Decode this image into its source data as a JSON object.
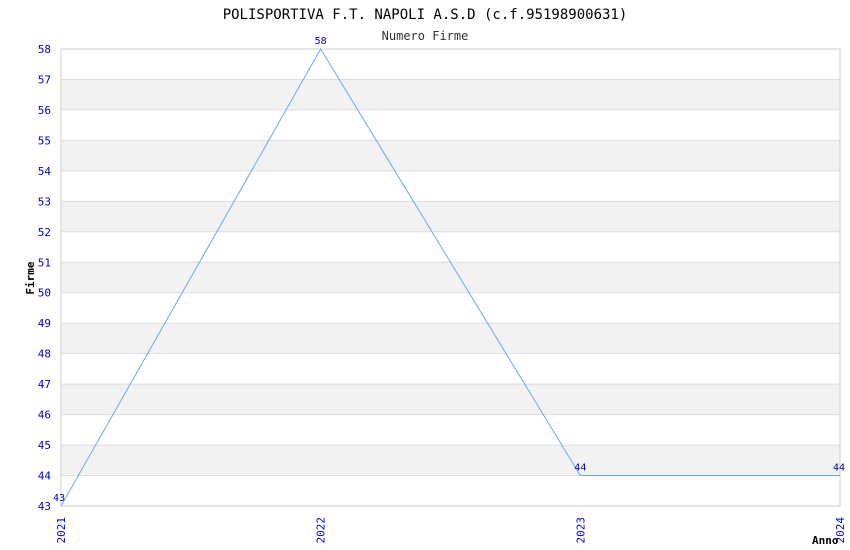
{
  "chart_data": {
    "type": "line",
    "title": "POLISPORTIVA F.T. NAPOLI A.S.D (c.f.95198900631)",
    "subtitle": "Numero Firme",
    "xlabel": "Anno",
    "ylabel": "Firme",
    "x": [
      "2021",
      "2022",
      "2023",
      "2024"
    ],
    "values": [
      43,
      58,
      44,
      44
    ],
    "ylim": [
      43,
      58
    ],
    "ystep": 1,
    "grid": true,
    "line_color": "#66aaee",
    "tick_color": "#0000cc",
    "band_color": "#f2f2f2"
  }
}
